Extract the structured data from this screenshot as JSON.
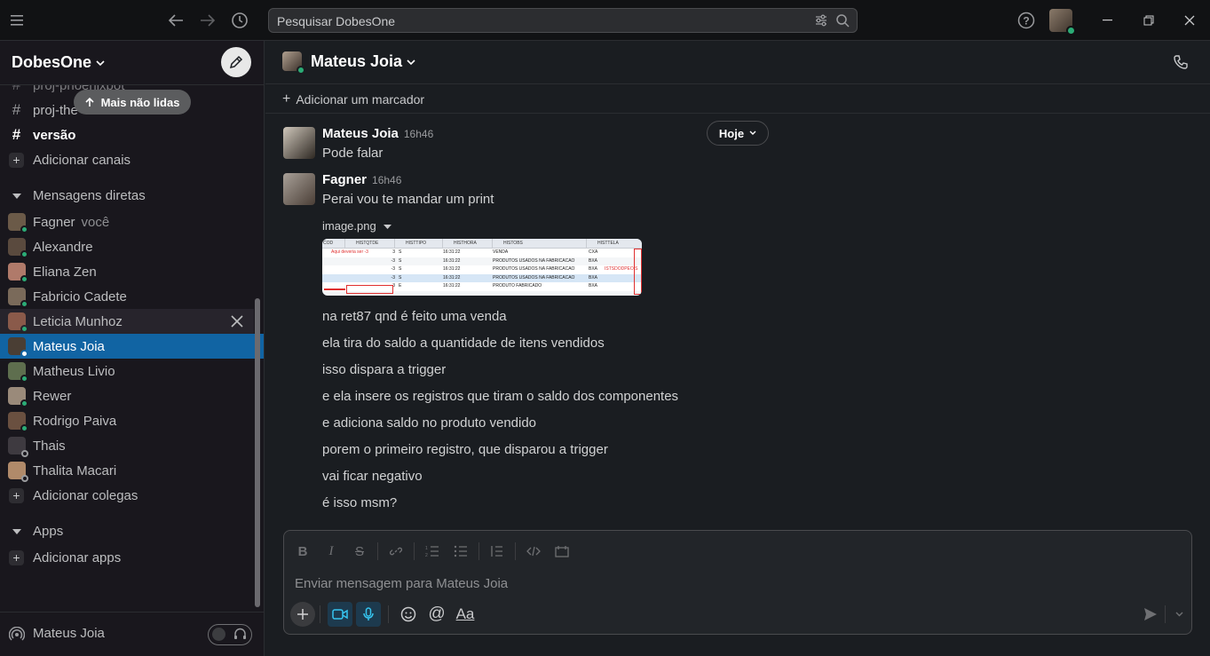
{
  "app": {
    "search_placeholder": "Pesquisar DobesOne"
  },
  "sidebar": {
    "workspace": "DobesOne",
    "unread_pill": "Mais não lidas",
    "channels": [
      {
        "label": "proj-phoenixbot",
        "bold": false
      },
      {
        "label": "proj-the",
        "bold": false
      },
      {
        "label": "versão",
        "bold": true
      }
    ],
    "add_channels": "Adicionar canais",
    "dm_section": "Mensagens diretas",
    "dms": [
      {
        "label": "Fagner",
        "sub": "você",
        "presence": "on",
        "color": "#6b5a48"
      },
      {
        "label": "Alexandre",
        "sub": "",
        "presence": "on",
        "color": "#5a4a3e"
      },
      {
        "label": "Eliana Zen",
        "sub": "",
        "presence": "on",
        "color": "#b07a6a"
      },
      {
        "label": "Fabricio Cadete",
        "sub": "",
        "presence": "on",
        "color": "#7a6a5a"
      },
      {
        "label": "Leticia Munhoz",
        "sub": "",
        "presence": "on",
        "color": "#8a5a4a"
      },
      {
        "label": "Mateus Joia",
        "sub": "",
        "presence": "on",
        "color": "#4a3e34"
      },
      {
        "label": "Matheus Livio",
        "sub": "",
        "presence": "on",
        "color": "#5e6e4e"
      },
      {
        "label": "Rewer",
        "sub": "",
        "presence": "on",
        "color": "#9a8a7a"
      },
      {
        "label": "Rodrigo Paiva",
        "sub": "",
        "presence": "on",
        "color": "#6a5040"
      },
      {
        "label": "Thais",
        "sub": "",
        "presence": "off",
        "color": "#3e3a40"
      },
      {
        "label": "Thalita Macari",
        "sub": "",
        "presence": "off",
        "color": "#b08a6a"
      }
    ],
    "add_colleagues": "Adicionar colegas",
    "apps_section": "Apps",
    "add_apps": "Adicionar apps",
    "footer_user": "Mateus Joia"
  },
  "channel": {
    "title": "Mateus Joia",
    "bookmark": "Adicionar um marcador",
    "date_pill": "Hoje",
    "messages": [
      {
        "author": "Mateus Joia",
        "time": "16h46",
        "text": "Pode falar"
      },
      {
        "author": "Fagner",
        "time": "16h46",
        "text": "Perai vou te mandar um print"
      }
    ],
    "attachment": {
      "filename": "image.png",
      "headers": [
        "COD",
        "HISTQTDE",
        "HISTTIPO",
        "HISTHORA",
        "HISTOBS",
        "HISTTELA"
      ],
      "note": "Aqui deveria ser -3",
      "rows": [
        {
          "qtde": "3",
          "tipo": "S",
          "hora": "16:31:22",
          "obs": "VENDA",
          "tela": "CXA"
        },
        {
          "qtde": "-3",
          "tipo": "S",
          "hora": "16:31:22",
          "obs": "PRODUTOS USADOS NA FABRICACAO",
          "tela": "BXA"
        },
        {
          "qtde": "-3",
          "tipo": "S",
          "hora": "16:31:22",
          "obs": "PRODUTOS USADOS NA FABRICACAO",
          "tela": "BXA"
        },
        {
          "qtde": "-3",
          "tipo": "S",
          "hora": "16:31:22",
          "obs": "PRODUTOS USADOS NA FABRICACAO",
          "tela": "BXA"
        },
        {
          "qtde": "3",
          "tipo": "E",
          "hora": "16:31:22",
          "obs": "PRODUTO FABRICADO",
          "tela": "BXA"
        }
      ],
      "overlay_text": "ISTSDODPEOIS"
    },
    "followups": [
      "na ret87 qnd é feito uma venda",
      "ela tira do saldo a quantidade de itens vendidos",
      "isso dispara a trigger",
      "e ela insere os registros que tiram o saldo dos componentes",
      "e adiciona saldo no produto vendido",
      "porem o primeiro registro, que disparou a trigger",
      "vai ficar negativo",
      "é isso msm?"
    ]
  },
  "composer": {
    "placeholder": "Enviar mensagem para Mateus Joia",
    "format_label": "Aa"
  }
}
